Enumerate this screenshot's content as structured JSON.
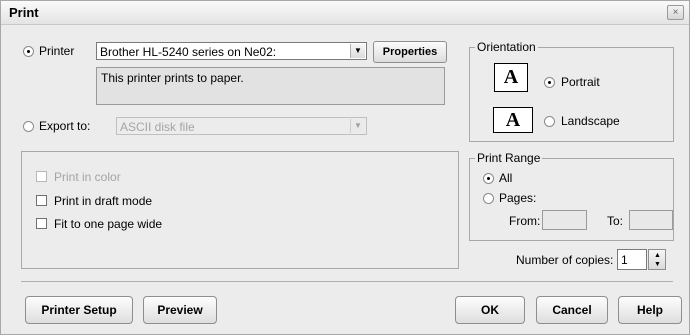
{
  "title": "Print",
  "close_glyph": "×",
  "printer": {
    "label": "Printer",
    "selected": "Brother HL-5240 series on Ne02:",
    "description": "This printer prints to paper.",
    "properties_label": "Properties"
  },
  "export": {
    "label": "Export to:",
    "selected": "ASCII disk file"
  },
  "options": {
    "print_in_color": "Print in color",
    "draft_mode": "Print in draft mode",
    "fit_one_page": "Fit to one page wide"
  },
  "orientation": {
    "legend": "Orientation",
    "icon_letter": "A",
    "portrait": "Portrait",
    "landscape": "Landscape"
  },
  "print_range": {
    "legend": "Print Range",
    "all": "All",
    "pages": "Pages:",
    "from": "From:",
    "to": "To:"
  },
  "copies": {
    "label": "Number of copies:",
    "value": "1"
  },
  "buttons": {
    "printer_setup": "Printer Setup",
    "preview": "Preview",
    "ok": "OK",
    "cancel": "Cancel",
    "help": "Help"
  }
}
